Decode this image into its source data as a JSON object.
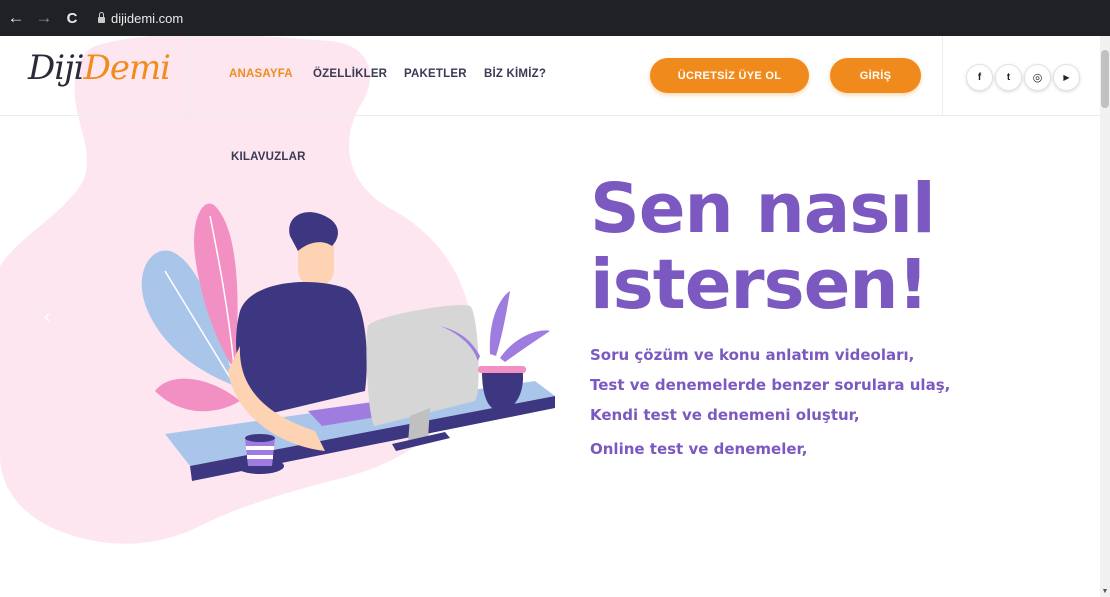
{
  "browser": {
    "url": "dijidemi.com",
    "back_icon": "←",
    "forward_icon": "→",
    "reload_icon": "C"
  },
  "logo": {
    "part1": "Diji",
    "part2": "Demi"
  },
  "nav": {
    "home": "ANASAYFA",
    "features": "ÖZELLİKLER",
    "packages": "PAKETLER",
    "about": "BİZ KİMİZ?",
    "guides": "KILAVUZLAR"
  },
  "buttons": {
    "signup": "ÜCRETSİZ ÜYE OL",
    "login": "GİRİŞ"
  },
  "social": {
    "facebook": "f",
    "twitter": "t",
    "instagram": "◎",
    "youtube": "▶"
  },
  "hero": {
    "line1": "Sen nasıl",
    "line2": "istersen!",
    "features": [
      "Soru çözüm ve konu anlatım videoları,",
      "Test ve denemelerde benzer sorulara ulaş,",
      "Kendi test ve denemeni oluştur,",
      "Online test ve denemeler,"
    ]
  },
  "colors": {
    "accent": "#f18a1c",
    "purple": "#7b59c0",
    "blob": "#fde8f1",
    "chrome": "#202124"
  },
  "slider_prev_icon": "‹"
}
